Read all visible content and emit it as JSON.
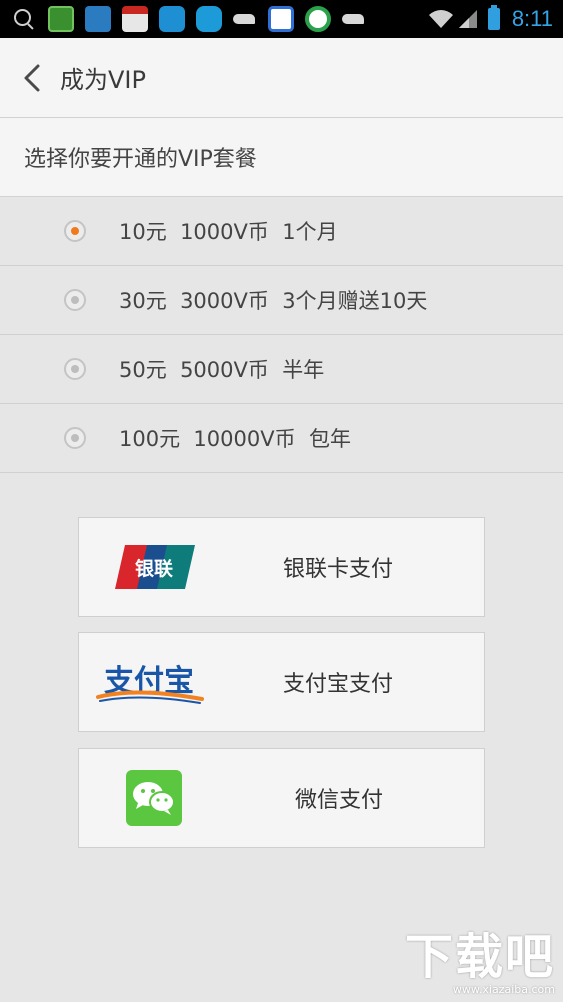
{
  "status_bar": {
    "time": "8:11",
    "battery_color": "#2f9fe0",
    "time_color": "#35a4e6"
  },
  "header": {
    "title": "成为VIP"
  },
  "section": {
    "title": "选择你要开通的VIP套餐"
  },
  "plans": [
    {
      "label": "10元  1000V币  1个月",
      "selected": true
    },
    {
      "label": "30元  3000V币  3个月赠送10天",
      "selected": false
    },
    {
      "label": "50元  5000V币  半年",
      "selected": false
    },
    {
      "label": "100元  10000V币  包年",
      "selected": false
    }
  ],
  "payments": [
    {
      "label": "银联卡支付",
      "logo_text": "银联",
      "icon": "unionpay-logo-icon"
    },
    {
      "label": "支付宝支付",
      "logo_text": "支付宝",
      "icon": "alipay-logo-icon"
    },
    {
      "label": "微信支付",
      "icon": "wechat-logo-icon"
    }
  ],
  "watermark": {
    "logo": "下载吧",
    "url": "www.xiazaiba.com"
  },
  "colors": {
    "accent_radio": "#f07a1e",
    "unionpay_red": "#d8262c",
    "unionpay_blue": "#1a4e8f",
    "unionpay_teal": "#0d7c7a",
    "alipay_blue": "#1a56a8",
    "alipay_orange": "#f2821f",
    "wechat_green": "#5bc63f"
  }
}
